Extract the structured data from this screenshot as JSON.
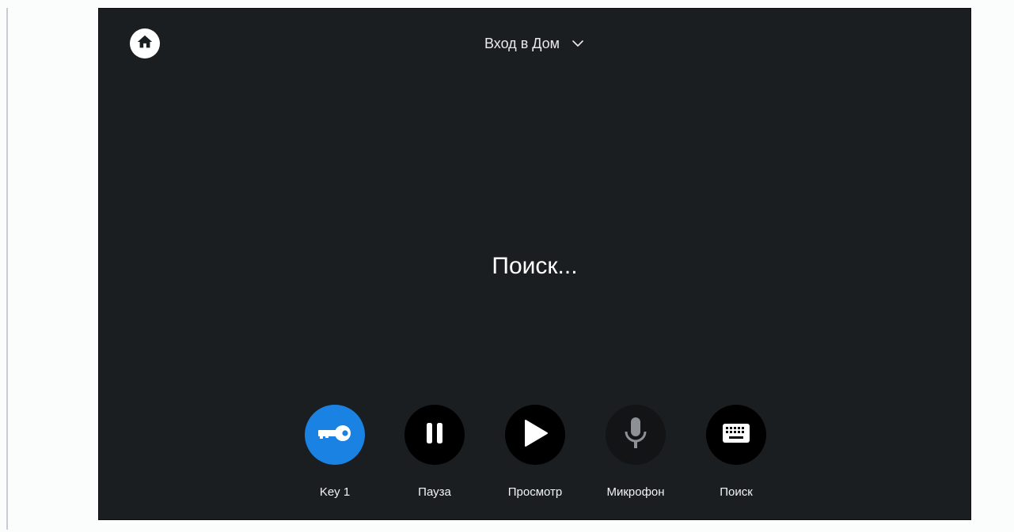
{
  "header": {
    "title": "Вход в Дом"
  },
  "status_text": "Поиск...",
  "actions": [
    {
      "label": "Key 1",
      "icon": "key-icon",
      "color": "#1a82e2"
    },
    {
      "label": "Пауза",
      "icon": "pause-icon",
      "color": "#000000"
    },
    {
      "label": "Просмотр",
      "icon": "play-icon",
      "color": "#000000"
    },
    {
      "label": "Микрофон",
      "icon": "microphone-icon",
      "color": "#121416"
    },
    {
      "label": "Поиск",
      "icon": "keyboard-icon",
      "color": "#000000"
    }
  ],
  "icons": {
    "home": "home-icon",
    "dropdown": "chevron-down-icon"
  }
}
